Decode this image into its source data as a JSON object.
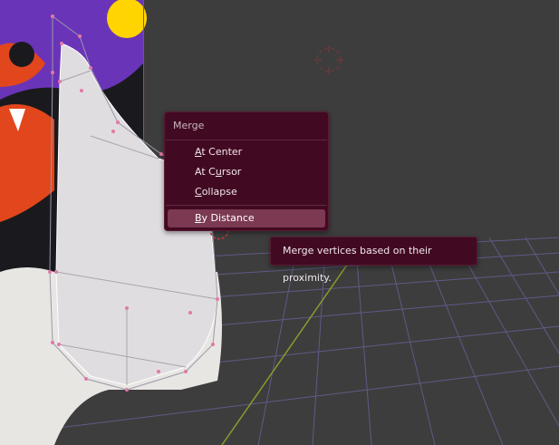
{
  "menu": {
    "title": "Merge",
    "items": [
      {
        "label": "At Center",
        "hotkey_index": 0,
        "active": false
      },
      {
        "label": "At Cursor",
        "hotkey_index": 4,
        "active": false
      },
      {
        "label": "Collapse",
        "hotkey_index": 0,
        "active": false
      },
      {
        "label": "By Distance",
        "hotkey_index": 0,
        "active": true
      }
    ]
  },
  "tooltip": {
    "text": "Merge vertices based on their proximity."
  },
  "colors": {
    "viewport_bg": "#3d3d3d",
    "menu_bg": "#420a22",
    "menu_highlight": "#7b3a52",
    "grid_line": "#6c63a0",
    "x_axis": "#8a9a2e",
    "vertex": "#e07aa8",
    "mesh_fill": "#e0dde0",
    "cursor_red": "#cc3a3a",
    "poster_purple": "#5a2aa0",
    "poster_orange": "#e2461c",
    "poster_yellow": "#ffd400"
  }
}
